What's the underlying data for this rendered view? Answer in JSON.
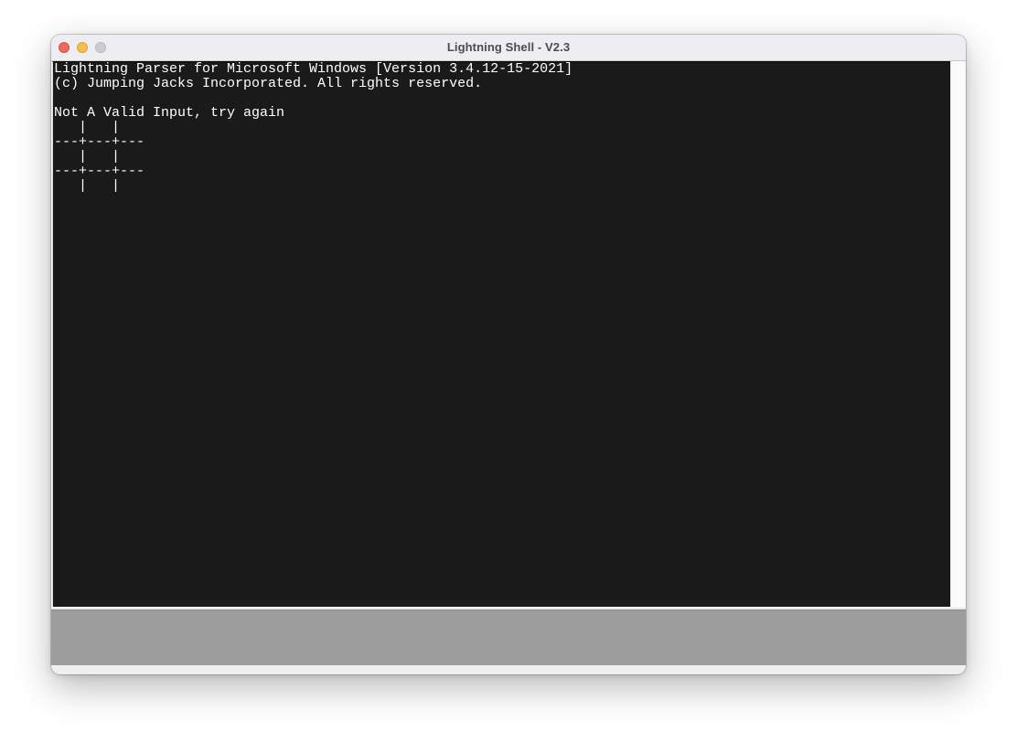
{
  "window": {
    "title": "Lightning Shell - V2.3",
    "controls": {
      "close": "close-button",
      "minimize": "minimize-button",
      "zoom": "zoom-button"
    },
    "colors": {
      "close": "#ec6a5e",
      "minimize": "#f4bf4f",
      "zoom": "#cdcdd0",
      "terminal_bg": "#1a1a1a",
      "terminal_fg": "#ffffff",
      "bottom_panel": "#9d9d9d"
    }
  },
  "terminal": {
    "lines": [
      "Lightning Parser for Microsoft Windows [Version 3.4.12-15-2021]",
      "(c) Jumping Jacks Incorporated. All rights reserved.",
      "",
      "Not A Valid Input, try again",
      "   |   |",
      "---+---+---",
      "   |   |",
      "---+---+---",
      "   |   |"
    ]
  }
}
